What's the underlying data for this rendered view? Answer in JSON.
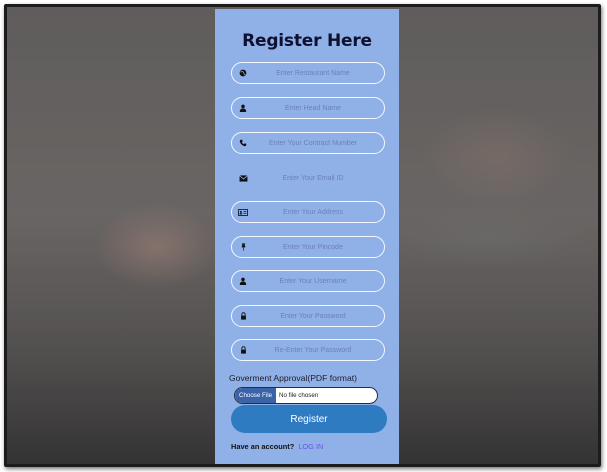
{
  "form": {
    "title": "Register Here",
    "fields": [
      {
        "placeholder": "Enter Restaurant Name",
        "icon": "globe-icon"
      },
      {
        "placeholder": "Enter Head Name",
        "icon": "user-icon"
      },
      {
        "placeholder": "Enter Your Contract Number",
        "icon": "phone-icon"
      },
      {
        "placeholder": "Enter Your Email ID",
        "icon": "envelope-icon"
      },
      {
        "placeholder": "Enter Your Address",
        "icon": "address-card-icon"
      },
      {
        "placeholder": "Enter Your Pincode",
        "icon": "pin-icon"
      },
      {
        "placeholder": "Enter Your Username",
        "icon": "user-icon"
      },
      {
        "placeholder": "Enter Your Password",
        "icon": "lock-icon"
      },
      {
        "placeholder": "Re-Enter Your Password",
        "icon": "lock-icon"
      }
    ],
    "government_label": "Goverment Approval(PDF format)",
    "file_button": "Choose File",
    "file_status": "No file chosen",
    "register_label": "Register",
    "have_account": "Have an account?",
    "login_label": "LOG IN"
  },
  "colors": {
    "panel": "#8fb1e8",
    "register_button": "#2f7bc2",
    "login_link": "#6a55e0",
    "title": "#0e1030"
  }
}
